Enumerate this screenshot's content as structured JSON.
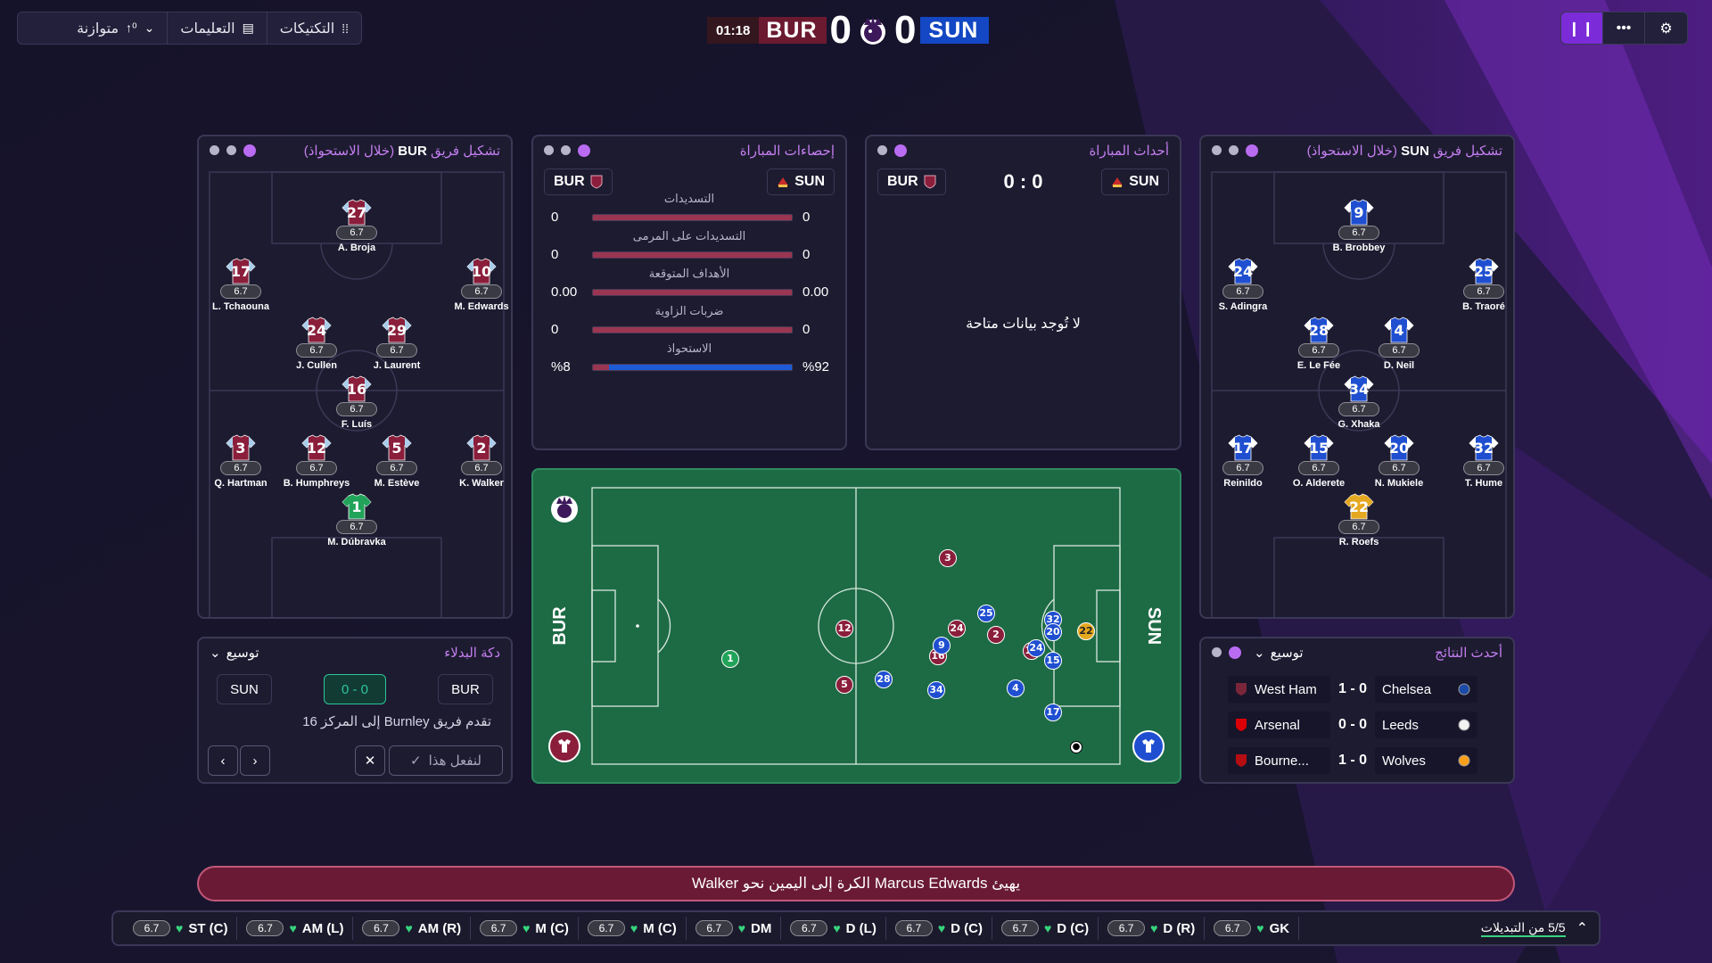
{
  "topbar": {
    "tactics_label": "التكتيكات",
    "instructions_label": "التعليمات",
    "mentality_label": "متوازنة"
  },
  "scoreboard": {
    "time": "01:18",
    "home": "BUR",
    "home_score": "0",
    "away_score": "0",
    "away": "SUN"
  },
  "colors": {
    "burnley": "#8a1e3b",
    "sunderland": "#1f4fd0",
    "accent": "#7b2bd8",
    "pitch": "#1d6b45"
  },
  "bur_formation": {
    "title_prefix": "تشكيل فريق",
    "team": "BUR",
    "title_suffix": "(خلال الاستحواذ)",
    "players": [
      {
        "num": "27",
        "rating": "6.7",
        "name": "A. Broja"
      },
      {
        "num": "17",
        "rating": "6.7",
        "name": "L. Tchaouna"
      },
      {
        "num": "10",
        "rating": "6.7",
        "name": "M. Edwards"
      },
      {
        "num": "24",
        "rating": "6.7",
        "name": "J. Cullen"
      },
      {
        "num": "29",
        "rating": "6.7",
        "name": "J. Laurent"
      },
      {
        "num": "16",
        "rating": "6.7",
        "name": "F. Luís"
      },
      {
        "num": "3",
        "rating": "6.7",
        "name": "Q. Hartman"
      },
      {
        "num": "12",
        "rating": "6.7",
        "name": "B. Humphreys"
      },
      {
        "num": "5",
        "rating": "6.7",
        "name": "M. Estève"
      },
      {
        "num": "2",
        "rating": "6.7",
        "name": "K. Walker"
      },
      {
        "num": "1",
        "rating": "6.7",
        "name": "M. Dúbravka"
      }
    ]
  },
  "sun_formation": {
    "title_prefix": "تشكيل فريق",
    "team": "SUN",
    "title_suffix": "(خلال الاستحواذ)",
    "players": [
      {
        "num": "9",
        "rating": "6.7",
        "name": "B. Brobbey"
      },
      {
        "num": "24",
        "rating": "6.7",
        "name": "S. Adingra"
      },
      {
        "num": "25",
        "rating": "6.7",
        "name": "B. Traoré"
      },
      {
        "num": "28",
        "rating": "6.7",
        "name": "E. Le Fée"
      },
      {
        "num": "4",
        "rating": "6.7",
        "name": "D. Neil"
      },
      {
        "num": "34",
        "rating": "6.7",
        "name": "G. Xhaka"
      },
      {
        "num": "17",
        "rating": "6.7",
        "name": "Reinildo"
      },
      {
        "num": "15",
        "rating": "6.7",
        "name": "O. Alderete"
      },
      {
        "num": "20",
        "rating": "6.7",
        "name": "N. Mukiele"
      },
      {
        "num": "32",
        "rating": "6.7",
        "name": "T. Hume"
      },
      {
        "num": "22",
        "rating": "6.7",
        "name": "R. Roefs"
      }
    ]
  },
  "match_stats": {
    "title": "إحصاءات المباراة",
    "home": "BUR",
    "away": "SUN",
    "rows": [
      {
        "label": "التسديدات",
        "home": "0",
        "away": "0",
        "home_share": 0.5
      },
      {
        "label": "التسديدات على المرمى",
        "home": "0",
        "away": "0",
        "home_share": 0.5
      },
      {
        "label": "الأهداف المتوقعة",
        "home": "0.00",
        "away": "0.00",
        "home_share": 0.5
      },
      {
        "label": "ضربات الزاوية",
        "home": "0",
        "away": "0",
        "home_share": 0.5
      },
      {
        "label": "الاستحواذ",
        "home": "%8",
        "away": "%92",
        "home_share": 0.08
      }
    ]
  },
  "match_events": {
    "title": "أحداث المباراة",
    "home": "BUR",
    "away": "SUN",
    "score": "0 : 0",
    "empty_text": "لا تُوجد بيانات متاحة"
  },
  "field": {
    "home_label": "BUR",
    "away_label": "SUN",
    "markers": [
      {
        "num": "1",
        "team": "gk1"
      },
      {
        "num": "3",
        "team": "bur"
      },
      {
        "num": "12",
        "team": "bur"
      },
      {
        "num": "5",
        "team": "bur"
      },
      {
        "num": "24",
        "team": "bur"
      },
      {
        "num": "16",
        "team": "bur"
      },
      {
        "num": "10",
        "team": "bur"
      },
      {
        "num": "2",
        "team": "bur"
      },
      {
        "num": "25",
        "team": "sun"
      },
      {
        "num": "9",
        "team": "sun"
      },
      {
        "num": "28",
        "team": "sun"
      },
      {
        "num": "24",
        "team": "sun"
      },
      {
        "num": "4",
        "team": "sun"
      },
      {
        "num": "34",
        "team": "sun"
      },
      {
        "num": "32",
        "team": "sun"
      },
      {
        "num": "20",
        "team": "sun"
      },
      {
        "num": "15",
        "team": "sun"
      },
      {
        "num": "17",
        "team": "sun"
      },
      {
        "num": "22",
        "team": "gk2"
      }
    ]
  },
  "bench": {
    "title": "دكة البدلاء",
    "expand_label": "توسيع",
    "away": "SUN",
    "score": "0 - 0",
    "home": "BUR",
    "message": "تقدم فريق Burnley إلى المركز 16",
    "action_label": "لنفعل هذا"
  },
  "results": {
    "title": "أحدث النتائج",
    "expand_label": "توسيع",
    "rows": [
      {
        "home": "West Ham",
        "score": "1 - 0",
        "away": "Chelsea"
      },
      {
        "home": "Arsenal",
        "score": "0 - 0",
        "away": "Leeds"
      },
      {
        "home": "Bourne...",
        "score": "1 - 0",
        "away": "Wolves"
      }
    ]
  },
  "commentary": "يهيئ Marcus Edwards الكرة إلى اليمين نحو Walker",
  "subs": {
    "label": "5/5 من التبديلات",
    "items": [
      {
        "rating": "6.7",
        "pos": "ST (C)"
      },
      {
        "rating": "6.7",
        "pos": "AM (L)"
      },
      {
        "rating": "6.7",
        "pos": "AM (R)"
      },
      {
        "rating": "6.7",
        "pos": "M (C)"
      },
      {
        "rating": "6.7",
        "pos": "M (C)"
      },
      {
        "rating": "6.7",
        "pos": "DM"
      },
      {
        "rating": "6.7",
        "pos": "D (L)"
      },
      {
        "rating": "6.7",
        "pos": "D (C)"
      },
      {
        "rating": "6.7",
        "pos": "D (C)"
      },
      {
        "rating": "6.7",
        "pos": "D (R)"
      },
      {
        "rating": "6.7",
        "pos": "GK"
      }
    ]
  }
}
